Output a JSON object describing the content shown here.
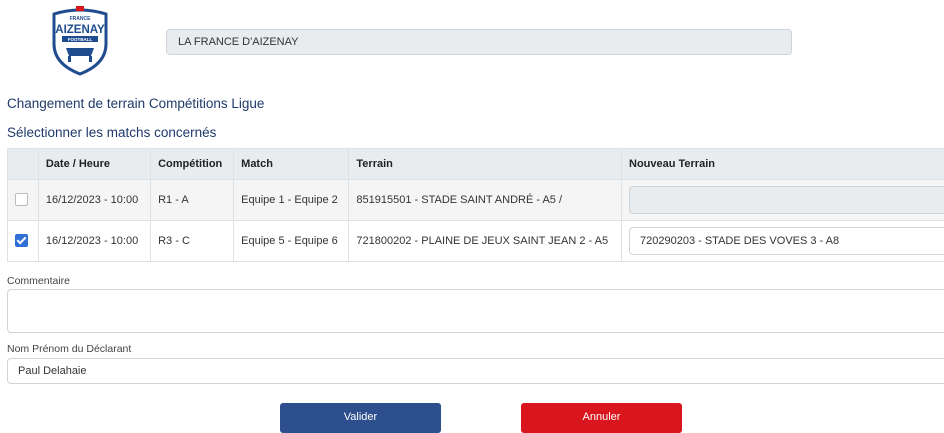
{
  "club": {
    "logo_top": "FRANCE",
    "logo_main": "AIZENAY",
    "logo_bottom": "FOOTBALL",
    "name": "LA FRANCE D'AIZENAY"
  },
  "page": {
    "title": "Changement de terrain Compétitions Ligue",
    "subtitle": "Sélectionner les matchs concernés"
  },
  "table": {
    "headers": [
      "Date / Heure",
      "Compétition",
      "Match",
      "Terrain",
      "Nouveau Terrain"
    ],
    "rows": [
      {
        "checked": false,
        "date": "16/12/2023 - 10:00",
        "competition": "R1 - A",
        "match": "Equipe 1 - Equipe 2",
        "terrain": "851915501 - STADE SAINT ANDRÉ - A5 /",
        "nouveau_terrain": ""
      },
      {
        "checked": true,
        "date": "16/12/2023 - 10:00",
        "competition": "R3 - C",
        "match": "Equipe 5 - Equipe 6",
        "terrain": "721800202 - PLAINE DE JEUX SAINT JEAN 2 - A5",
        "nouveau_terrain": "720290203 - STADE DES VOVES 3 - A8"
      }
    ]
  },
  "form": {
    "comment_label": "Commentaire",
    "comment_value": "",
    "declarant_label": "Nom Prénom du Déclarant",
    "declarant_value": "Paul Delahaie"
  },
  "buttons": {
    "validate": "Valider",
    "cancel": "Annuler"
  },
  "colors": {
    "primary": "#2d4f8d",
    "danger": "#d9161d",
    "heading": "#1f3a6b",
    "checkbox": "#2f6fd6"
  }
}
